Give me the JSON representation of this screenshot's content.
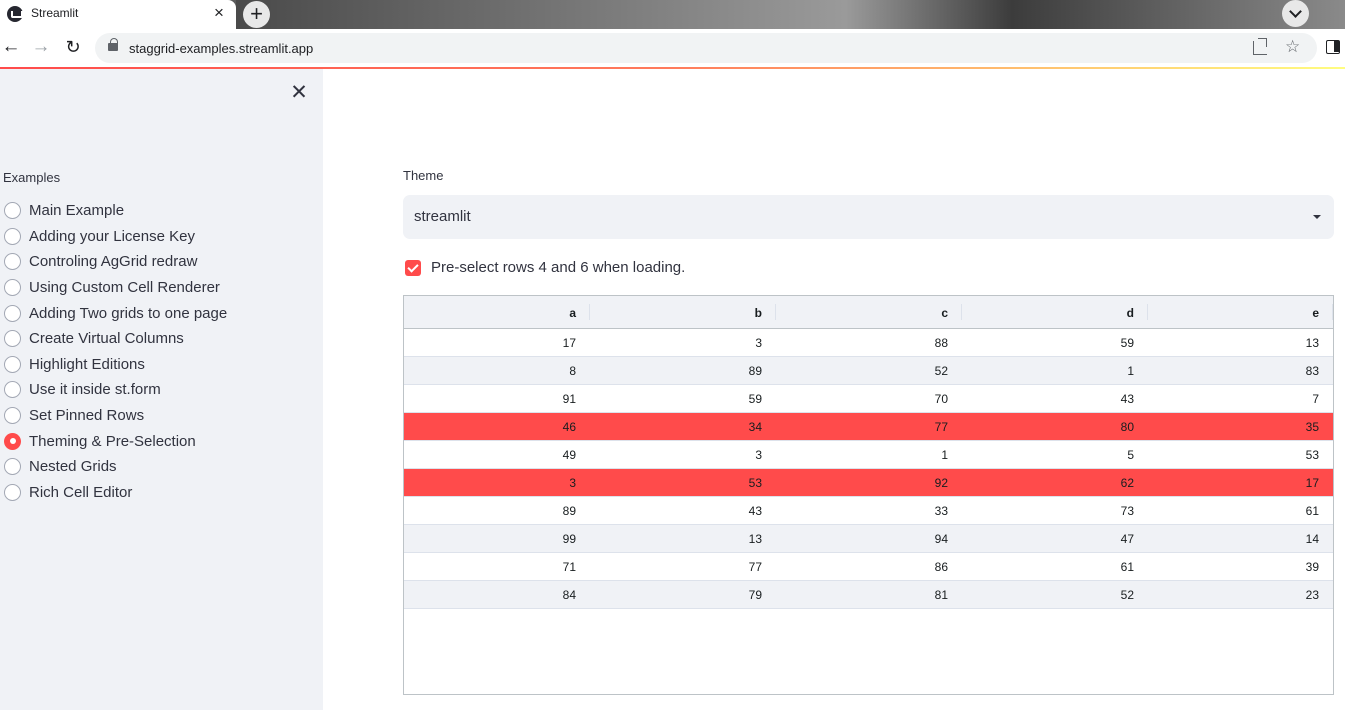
{
  "browser": {
    "tab_title": "Streamlit",
    "url": "staggrid-examples.streamlit.app"
  },
  "sidebar": {
    "radio_label": "Examples",
    "items": [
      {
        "label": "Main Example",
        "selected": false
      },
      {
        "label": "Adding your License Key",
        "selected": false
      },
      {
        "label": "Controling AgGrid redraw",
        "selected": false
      },
      {
        "label": "Using Custom Cell Renderer",
        "selected": false
      },
      {
        "label": "Adding Two grids to one page",
        "selected": false
      },
      {
        "label": "Create Virtual Columns",
        "selected": false
      },
      {
        "label": "Highlight Editions",
        "selected": false
      },
      {
        "label": "Use it inside st.form",
        "selected": false
      },
      {
        "label": "Set Pinned Rows",
        "selected": false
      },
      {
        "label": "Theming & Pre-Selection",
        "selected": true
      },
      {
        "label": "Nested Grids",
        "selected": false
      },
      {
        "label": "Rich Cell Editor",
        "selected": false
      }
    ]
  },
  "main": {
    "theme_label": "Theme",
    "theme_value": "streamlit",
    "checkbox_label": "Pre-select rows 4 and 6 when loading.",
    "checkbox_checked": true
  },
  "grid": {
    "columns": [
      "a",
      "b",
      "c",
      "d",
      "e"
    ],
    "rows": [
      {
        "cells": [
          "17",
          "3",
          "88",
          "59",
          "13"
        ],
        "selected": false
      },
      {
        "cells": [
          "8",
          "89",
          "52",
          "1",
          "83"
        ],
        "selected": false
      },
      {
        "cells": [
          "91",
          "59",
          "70",
          "43",
          "7"
        ],
        "selected": false
      },
      {
        "cells": [
          "46",
          "34",
          "77",
          "80",
          "35"
        ],
        "selected": true
      },
      {
        "cells": [
          "49",
          "3",
          "1",
          "5",
          "53"
        ],
        "selected": false
      },
      {
        "cells": [
          "3",
          "53",
          "92",
          "62",
          "17"
        ],
        "selected": true
      },
      {
        "cells": [
          "89",
          "43",
          "33",
          "73",
          "61"
        ],
        "selected": false
      },
      {
        "cells": [
          "99",
          "13",
          "94",
          "47",
          "14"
        ],
        "selected": false
      },
      {
        "cells": [
          "71",
          "77",
          "86",
          "61",
          "39"
        ],
        "selected": false
      },
      {
        "cells": [
          "84",
          "79",
          "81",
          "52",
          "23"
        ],
        "selected": false
      }
    ]
  },
  "colors": {
    "accent": "#ff4b4b",
    "sidebar_bg": "#f0f2f6",
    "text": "#31333f"
  }
}
